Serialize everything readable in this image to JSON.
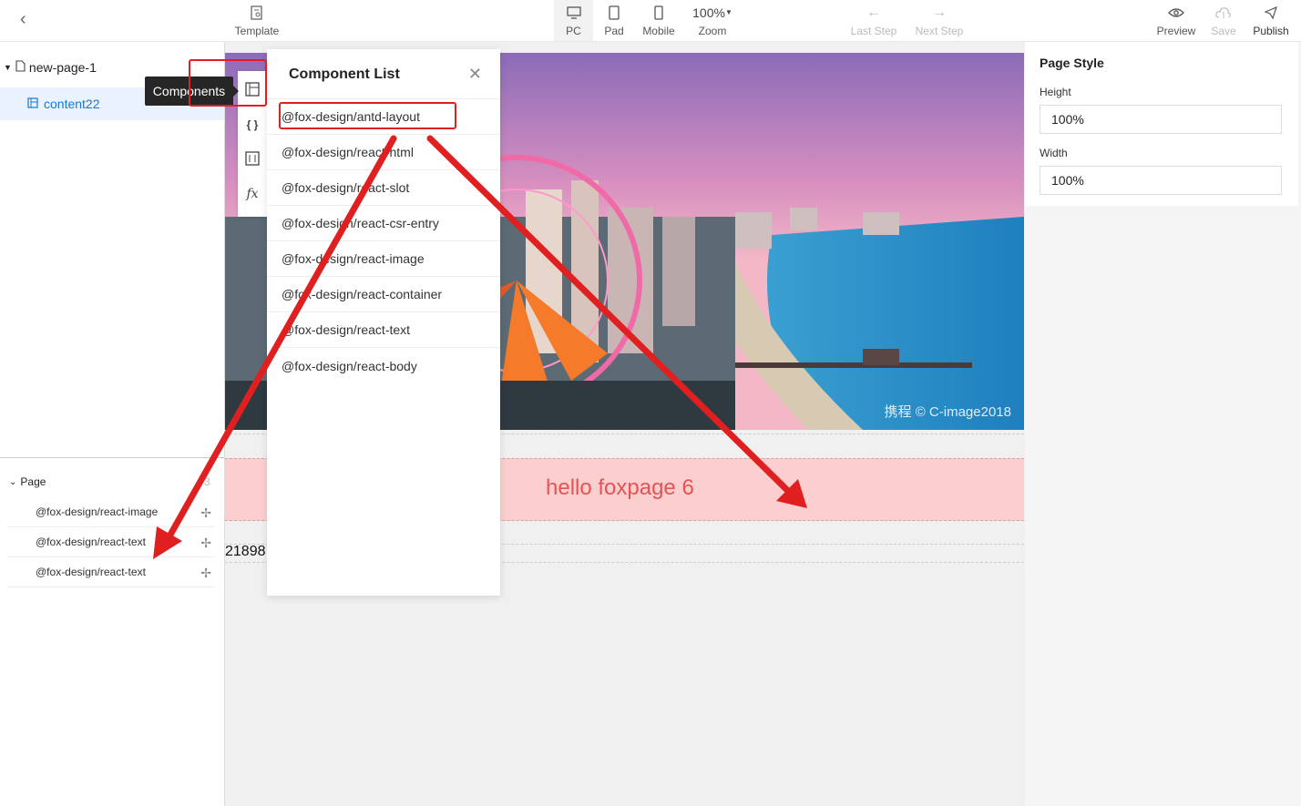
{
  "toolbar": {
    "template": "Template",
    "pc": "PC",
    "pad": "Pad",
    "mobile": "Mobile",
    "zoom_value": "100%",
    "zoom": "Zoom",
    "last_step": "Last Step",
    "next_step": "Next Step",
    "preview": "Preview",
    "save": "Save",
    "publish": "Publish"
  },
  "tree": {
    "root": "new-page-1",
    "child": "content22"
  },
  "tooltip": "Components",
  "layers": {
    "page_label": "Page",
    "count": "3",
    "items": [
      "@fox-design/react-image",
      "@fox-design/react-text",
      "@fox-design/react-text"
    ]
  },
  "component_list": {
    "title": "Component List",
    "items": [
      "@fox-design/antd-layout",
      "@fox-design/react-html",
      "@fox-design/react-slot",
      "@fox-design/react-csr-entry",
      "@fox-design/react-image",
      "@fox-design/react-container",
      "@fox-design/react-text",
      "@fox-design/react-body"
    ]
  },
  "canvas": {
    "watermark": "携程 © C-image2018",
    "hello_text": "hello foxpage 6",
    "number_text": "21898"
  },
  "page_style": {
    "title": "Page Style",
    "height_label": "Height",
    "height_value": "100%",
    "width_label": "Width",
    "width_value": "100%"
  },
  "colors": {
    "annotation": "#e02020",
    "accent": "#1677d8",
    "band": "#fbcfcf"
  }
}
